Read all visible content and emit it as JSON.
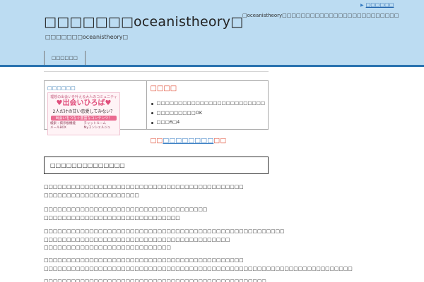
{
  "header": {
    "site_title": "□□□□□□□oceanistheory□",
    "description": "□oceanistheory□□□□□□□□□□□□□□□□□□□□□□□□□",
    "top_link_label": "□□□□□□",
    "sub_title": "□□□□□□□oceanistheory□",
    "nav_item": "□□□□□□"
  },
  "table": {
    "left_heading": "□□□□□□",
    "banner": {
      "line1": "理想の出会いを叶える大人のコミュニティ",
      "line2": "出会いひろば",
      "line3": "2人だけの甘い恋愛してみない？",
      "line4": "出会いをつなぐ豊富なコンテンツ！",
      "features": [
        "検索・掲示板機能",
        "チャットルーム",
        "メールBOX",
        "Myコンシェルジュ"
      ]
    },
    "right_heading": "□□□□",
    "features": [
      "□□□□□□□□□□□□□□□□□□□□□□□□□",
      "□□□□□□□□□OK",
      "□□□6□4"
    ],
    "cta_bracket_open": "□□",
    "cta_link": "□□□□□□□□",
    "cta_bracket_close": "□□"
  },
  "boxed_heading": "□□□□□□□□□□□□□□",
  "paragraphs": [
    [
      "□□□□□□□□□□□□□□□□□□□□□□□□□□□□□□□□□□□□□□□□□□□□",
      "□□□□□□□□□□□□□□□□□□□□□"
    ],
    [
      "□□□□□□□□□□□□□□□□□□□□□□□□□□□□□□□□□□□□",
      "□□□□□□□□□□□□□□□□□□□□□□□□□□□□□□"
    ],
    [
      "□□□□□□□□□□□□□□□□□□□□□□□□□□□□□□□□□□□□□□□□□□□□□□□□□□□□□",
      "□□□□□□□□□□□□□□□□□□□□□□□□□□□□□□□□□□□□□□□□□",
      "□□□□□□□□□□□□□□□□□□□□□□□□□□□□"
    ],
    [
      "□□□□□□□□□□□□□□□□□□□□□□□□□□□□□□□□□□□□□□□□□□□□",
      "□□□□□□□□□□□□□□□□□□□□□□□□□□□□□□□□□□□□□□□□□□□□□□□□□□□□□□□□□□□□□□□□□□□□"
    ],
    [
      "□□□□□□□□□□□□□□□□□□□□□□□□□□□□□□□□□□□□□□□□□□□□□□□□□"
    ]
  ],
  "colors": {
    "header_bg": "#bcdcf2",
    "header_line": "#2a73b0",
    "accent_red": "#e0503a",
    "link_blue": "#3a7fc4"
  }
}
